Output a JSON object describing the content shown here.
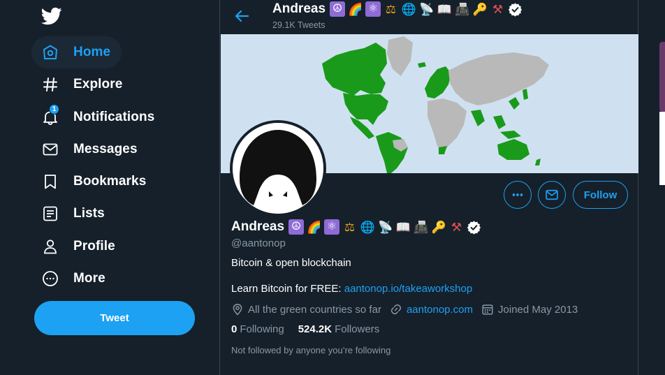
{
  "sidebar": {
    "items": [
      {
        "label": "Home",
        "icon": "home-icon",
        "active": true
      },
      {
        "label": "Explore",
        "icon": "hashtag-icon"
      },
      {
        "label": "Notifications",
        "icon": "bell-icon",
        "badge": "1"
      },
      {
        "label": "Messages",
        "icon": "envelope-icon"
      },
      {
        "label": "Bookmarks",
        "icon": "bookmark-icon"
      },
      {
        "label": "Lists",
        "icon": "list-icon"
      },
      {
        "label": "Profile",
        "icon": "person-icon"
      },
      {
        "label": "More",
        "icon": "more-circle-icon"
      }
    ],
    "tweet_label": "Tweet"
  },
  "header": {
    "name": "Andreas",
    "tweets_count": "29.1K Tweets"
  },
  "emojis": [
    "☮",
    "🌈",
    "⚛",
    "⚖",
    "🌐",
    "📡",
    "📖",
    "📠",
    "🔑",
    "⚒"
  ],
  "profile": {
    "name": "Andreas",
    "handle": "@aantonop",
    "bio": "Bitcoin & open blockchain",
    "bio2_prefix": "Learn Bitcoin for FREE: ",
    "bio2_link": "aantonop.io/takeaworkshop",
    "location": "All the green countries so far",
    "website": "aantonop.com",
    "joined": "Joined May 2013",
    "following_count": "0",
    "following_label": "Following",
    "followers_count": "524.2K",
    "followers_label": "Followers",
    "not_followed": "Not followed by anyone you’re following",
    "follow_label": "Follow"
  },
  "colors": {
    "accent": "#1da1f2",
    "background": "#15202b",
    "secondary_text": "#8899a6",
    "map_green": "#1a9a1a",
    "map_gray": "#b9b9b9",
    "map_water": "#cfe1f1"
  }
}
